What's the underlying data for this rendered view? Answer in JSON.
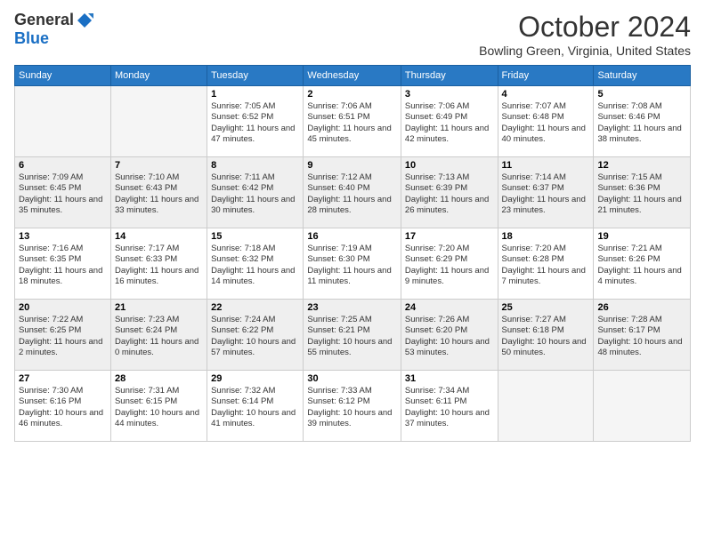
{
  "logo": {
    "general": "General",
    "blue": "Blue"
  },
  "title": "October 2024",
  "location": "Bowling Green, Virginia, United States",
  "days_header": [
    "Sunday",
    "Monday",
    "Tuesday",
    "Wednesday",
    "Thursday",
    "Friday",
    "Saturday"
  ],
  "weeks": [
    [
      {
        "day": "",
        "info": ""
      },
      {
        "day": "",
        "info": ""
      },
      {
        "day": "1",
        "info": "Sunrise: 7:05 AM\nSunset: 6:52 PM\nDaylight: 11 hours and 47 minutes."
      },
      {
        "day": "2",
        "info": "Sunrise: 7:06 AM\nSunset: 6:51 PM\nDaylight: 11 hours and 45 minutes."
      },
      {
        "day": "3",
        "info": "Sunrise: 7:06 AM\nSunset: 6:49 PM\nDaylight: 11 hours and 42 minutes."
      },
      {
        "day": "4",
        "info": "Sunrise: 7:07 AM\nSunset: 6:48 PM\nDaylight: 11 hours and 40 minutes."
      },
      {
        "day": "5",
        "info": "Sunrise: 7:08 AM\nSunset: 6:46 PM\nDaylight: 11 hours and 38 minutes."
      }
    ],
    [
      {
        "day": "6",
        "info": "Sunrise: 7:09 AM\nSunset: 6:45 PM\nDaylight: 11 hours and 35 minutes."
      },
      {
        "day": "7",
        "info": "Sunrise: 7:10 AM\nSunset: 6:43 PM\nDaylight: 11 hours and 33 minutes."
      },
      {
        "day": "8",
        "info": "Sunrise: 7:11 AM\nSunset: 6:42 PM\nDaylight: 11 hours and 30 minutes."
      },
      {
        "day": "9",
        "info": "Sunrise: 7:12 AM\nSunset: 6:40 PM\nDaylight: 11 hours and 28 minutes."
      },
      {
        "day": "10",
        "info": "Sunrise: 7:13 AM\nSunset: 6:39 PM\nDaylight: 11 hours and 26 minutes."
      },
      {
        "day": "11",
        "info": "Sunrise: 7:14 AM\nSunset: 6:37 PM\nDaylight: 11 hours and 23 minutes."
      },
      {
        "day": "12",
        "info": "Sunrise: 7:15 AM\nSunset: 6:36 PM\nDaylight: 11 hours and 21 minutes."
      }
    ],
    [
      {
        "day": "13",
        "info": "Sunrise: 7:16 AM\nSunset: 6:35 PM\nDaylight: 11 hours and 18 minutes."
      },
      {
        "day": "14",
        "info": "Sunrise: 7:17 AM\nSunset: 6:33 PM\nDaylight: 11 hours and 16 minutes."
      },
      {
        "day": "15",
        "info": "Sunrise: 7:18 AM\nSunset: 6:32 PM\nDaylight: 11 hours and 14 minutes."
      },
      {
        "day": "16",
        "info": "Sunrise: 7:19 AM\nSunset: 6:30 PM\nDaylight: 11 hours and 11 minutes."
      },
      {
        "day": "17",
        "info": "Sunrise: 7:20 AM\nSunset: 6:29 PM\nDaylight: 11 hours and 9 minutes."
      },
      {
        "day": "18",
        "info": "Sunrise: 7:20 AM\nSunset: 6:28 PM\nDaylight: 11 hours and 7 minutes."
      },
      {
        "day": "19",
        "info": "Sunrise: 7:21 AM\nSunset: 6:26 PM\nDaylight: 11 hours and 4 minutes."
      }
    ],
    [
      {
        "day": "20",
        "info": "Sunrise: 7:22 AM\nSunset: 6:25 PM\nDaylight: 11 hours and 2 minutes."
      },
      {
        "day": "21",
        "info": "Sunrise: 7:23 AM\nSunset: 6:24 PM\nDaylight: 11 hours and 0 minutes."
      },
      {
        "day": "22",
        "info": "Sunrise: 7:24 AM\nSunset: 6:22 PM\nDaylight: 10 hours and 57 minutes."
      },
      {
        "day": "23",
        "info": "Sunrise: 7:25 AM\nSunset: 6:21 PM\nDaylight: 10 hours and 55 minutes."
      },
      {
        "day": "24",
        "info": "Sunrise: 7:26 AM\nSunset: 6:20 PM\nDaylight: 10 hours and 53 minutes."
      },
      {
        "day": "25",
        "info": "Sunrise: 7:27 AM\nSunset: 6:18 PM\nDaylight: 10 hours and 50 minutes."
      },
      {
        "day": "26",
        "info": "Sunrise: 7:28 AM\nSunset: 6:17 PM\nDaylight: 10 hours and 48 minutes."
      }
    ],
    [
      {
        "day": "27",
        "info": "Sunrise: 7:30 AM\nSunset: 6:16 PM\nDaylight: 10 hours and 46 minutes."
      },
      {
        "day": "28",
        "info": "Sunrise: 7:31 AM\nSunset: 6:15 PM\nDaylight: 10 hours and 44 minutes."
      },
      {
        "day": "29",
        "info": "Sunrise: 7:32 AM\nSunset: 6:14 PM\nDaylight: 10 hours and 41 minutes."
      },
      {
        "day": "30",
        "info": "Sunrise: 7:33 AM\nSunset: 6:12 PM\nDaylight: 10 hours and 39 minutes."
      },
      {
        "day": "31",
        "info": "Sunrise: 7:34 AM\nSunset: 6:11 PM\nDaylight: 10 hours and 37 minutes."
      },
      {
        "day": "",
        "info": ""
      },
      {
        "day": "",
        "info": ""
      }
    ]
  ]
}
